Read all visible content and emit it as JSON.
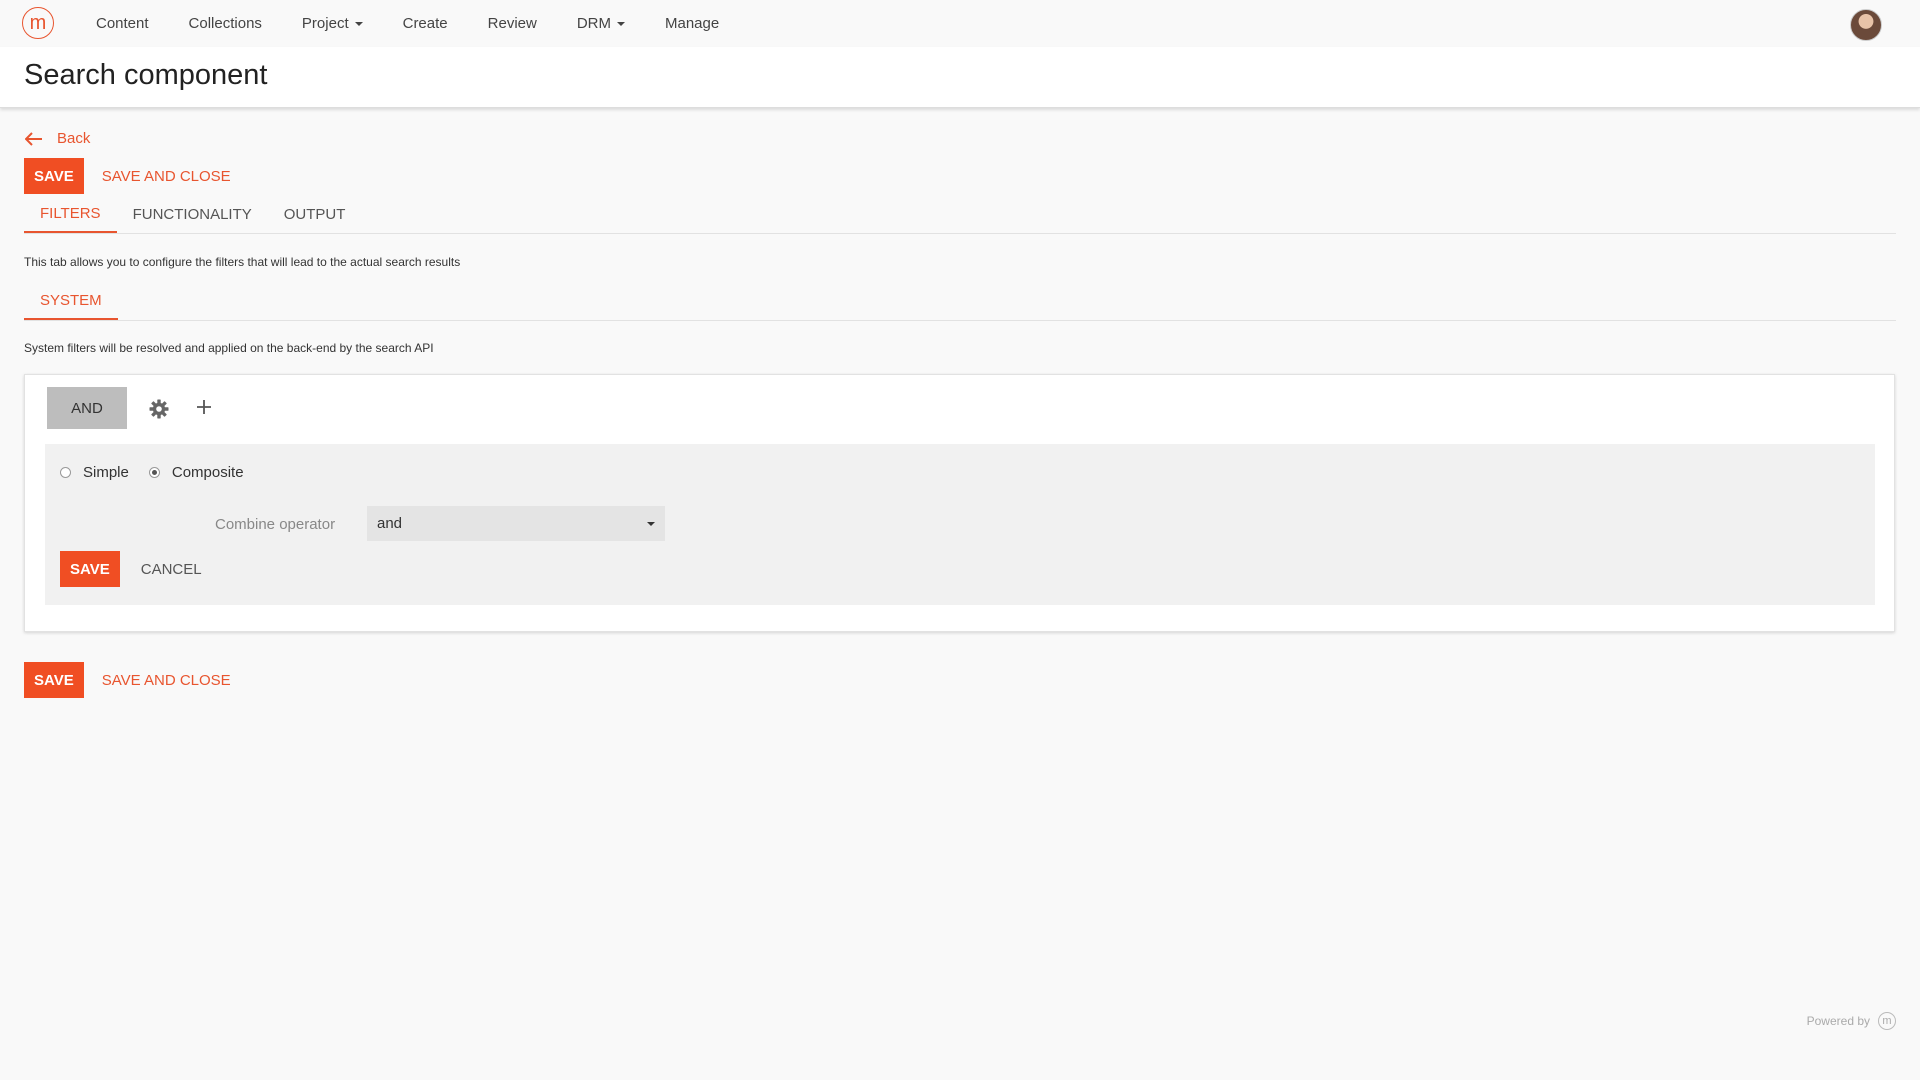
{
  "nav": {
    "logo_glyph": "m",
    "items": [
      {
        "label": "Content",
        "dropdown": false
      },
      {
        "label": "Collections",
        "dropdown": false
      },
      {
        "label": "Project",
        "dropdown": true
      },
      {
        "label": "Create",
        "dropdown": false
      },
      {
        "label": "Review",
        "dropdown": false
      },
      {
        "label": "DRM",
        "dropdown": true
      },
      {
        "label": "Manage",
        "dropdown": false
      }
    ]
  },
  "header": {
    "title": "Search component"
  },
  "back": {
    "label": "Back"
  },
  "actions_top": {
    "save": "SAVE",
    "save_and_close": "SAVE AND CLOSE"
  },
  "tabs": [
    {
      "label": "FILTERS",
      "active": true
    },
    {
      "label": "FUNCTIONALITY",
      "active": false
    },
    {
      "label": "OUTPUT",
      "active": false
    }
  ],
  "tab_description": "This tab allows you to configure the filters that will lead to the actual search results",
  "subtabs": [
    {
      "label": "SYSTEM",
      "active": true
    }
  ],
  "system_description": "System filters will be resolved and applied on the back-end by the search API",
  "filter_panel": {
    "operator_button": "AND",
    "icons": [
      "gear-icon",
      "plus-icon"
    ],
    "editor": {
      "radio_options": [
        {
          "label": "Simple",
          "checked": false
        },
        {
          "label": "Composite",
          "checked": true
        }
      ],
      "combine_label": "Combine operator",
      "combine_value": "and",
      "save": "SAVE",
      "cancel": "CANCEL"
    }
  },
  "actions_bottom": {
    "save": "SAVE",
    "save_and_close": "SAVE AND CLOSE"
  },
  "footer": {
    "powered_by": "Powered by",
    "logo_glyph": "m"
  },
  "colors": {
    "accent": "#f04e23",
    "link": "#e8552f",
    "operator_bg": "#bdbdbd",
    "editor_bg": "#f1f1f1"
  }
}
